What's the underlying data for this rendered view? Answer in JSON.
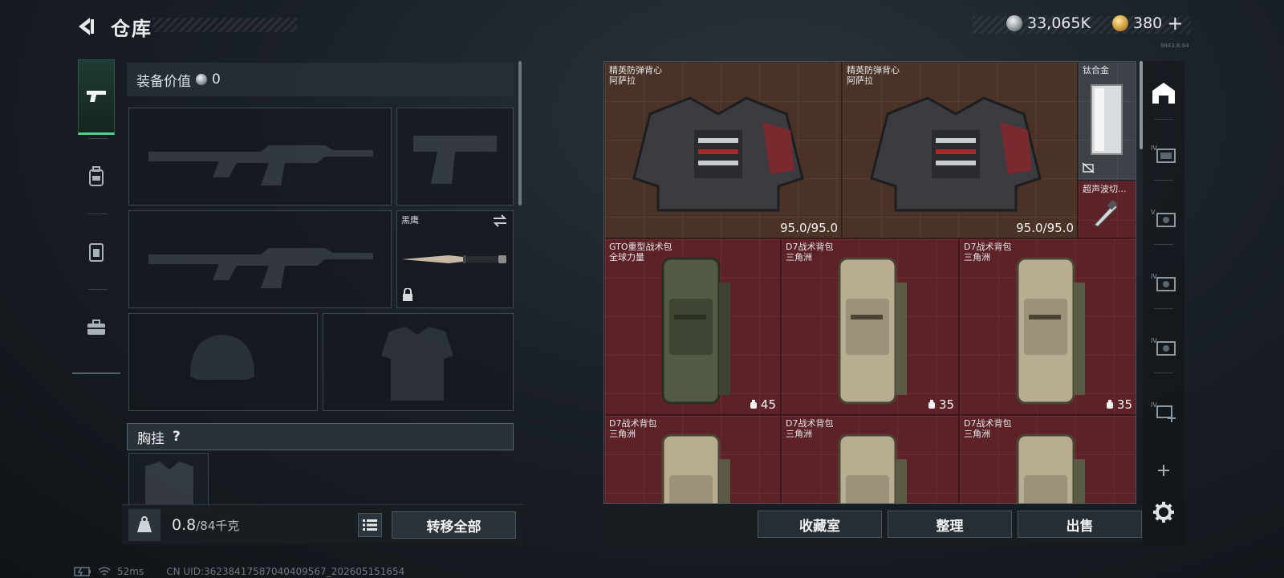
{
  "header": {
    "title": "仓库",
    "currency_coin": "33,065K",
    "currency_gold": "380",
    "add_symbol": "+",
    "version_tiny": "9843.8.64"
  },
  "left_nav": {
    "items": [
      "pistol-icon",
      "backpack-icon",
      "vest-icon",
      "toolbox-icon"
    ],
    "active": "pistol-icon"
  },
  "loadout": {
    "equip_value_label": "装备价值",
    "equip_value": "0",
    "melee_name": "黑鹰",
    "chest_rig_label": "胸挂",
    "help_mark": "?"
  },
  "weight": {
    "current": "0.8",
    "max": "/84千克"
  },
  "buttons": {
    "transfer_all": "转移全部",
    "collection": "收藏室",
    "organize": "整理",
    "sell": "出售"
  },
  "storage": {
    "items": [
      {
        "name": "精英防弹背心\n阿萨拉",
        "durability": "95.0/95.0"
      },
      {
        "name": "精英防弹背心\n阿萨拉",
        "durability": "95.0/95.0"
      },
      {
        "name": "钛合金"
      },
      {
        "name": "超声波切..."
      },
      {
        "name": "GTO重型战术包\n全球力量",
        "capacity": "45"
      },
      {
        "name": "D7战术背包\n三角洲",
        "capacity": "35"
      },
      {
        "name": "D7战术背包\n三角洲",
        "capacity": "35"
      },
      {
        "name": "D7战术背包\n三角洲"
      },
      {
        "name": "D7战术背包\n三角洲"
      },
      {
        "name": "D7战术背包\n三角洲"
      }
    ]
  },
  "status": {
    "ping": "52ms",
    "uid": "CN UID:3623841758704040956​7_202605151654"
  },
  "colors": {
    "accent_green": "#4cd38a",
    "rarity_red": "#5c2228",
    "rarity_brown": "#4a3326"
  }
}
